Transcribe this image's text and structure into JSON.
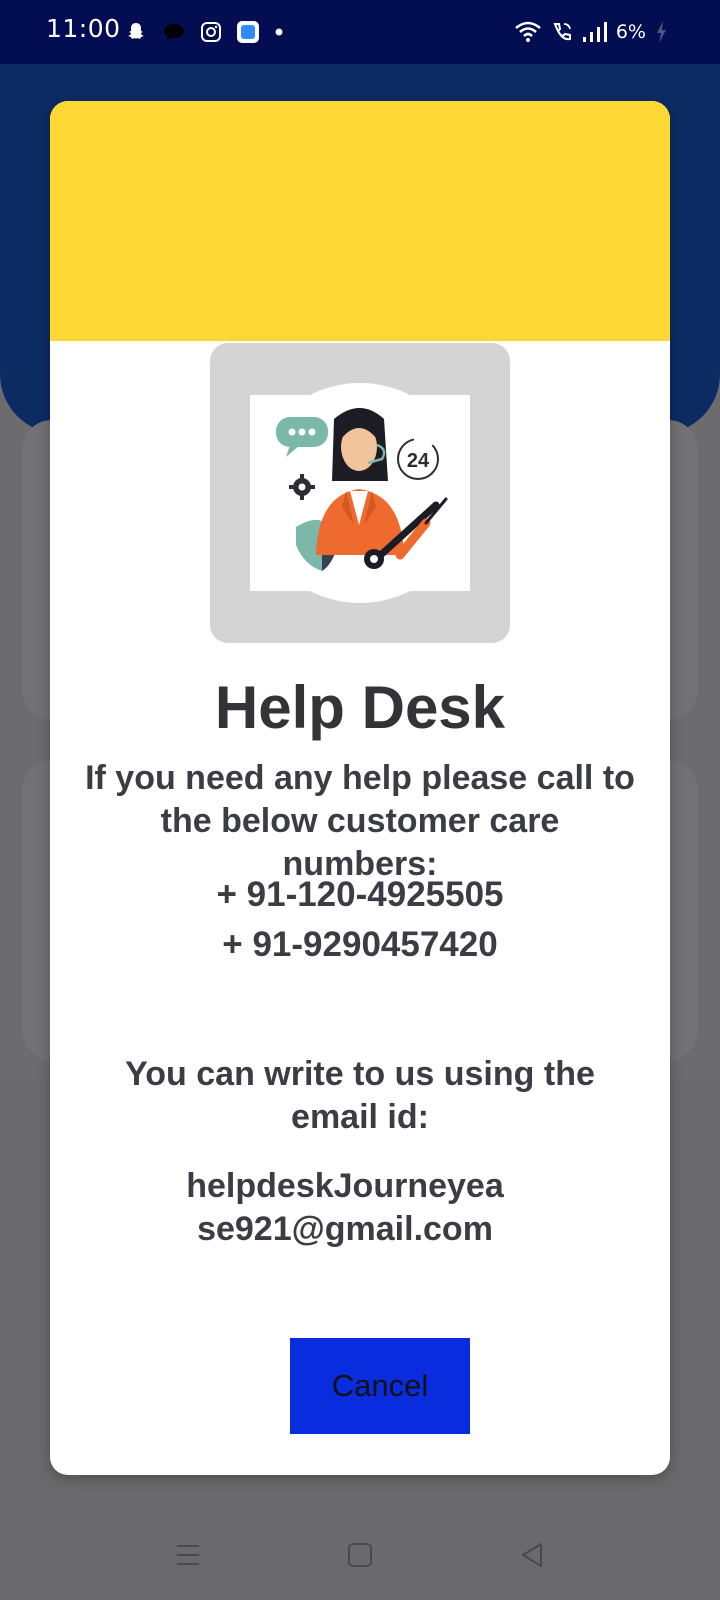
{
  "status_bar": {
    "time": "11:00",
    "battery": "6%",
    "left_icons": [
      "snapchat-icon",
      "chat-bubble-icon",
      "instagram-icon",
      "app-icon",
      "dot-icon"
    ],
    "right_icons": [
      "wifi-icon",
      "wifi-call-icon",
      "signal-icon",
      "battery-icon"
    ]
  },
  "dialog": {
    "title": "Help Desk",
    "message": "If you need any help please call to the below customer care numbers:",
    "phones": [
      "+ 91-120-4925505",
      "+ 91-9290457420"
    ],
    "email_label": "You can write to us using the email id:",
    "email": "helpdeskJourneyease921@gmail.com",
    "cancel_label": "Cancel",
    "illustration": "customer-support-agent-illustration"
  },
  "colors": {
    "status_bar": "#030d52",
    "header_yellow": "#fdd734",
    "button_blue": "#0a2cdf",
    "text_dark": "#3c3c44"
  },
  "nav_bar": {
    "buttons": [
      "menu-icon",
      "home-icon",
      "back-icon"
    ]
  }
}
